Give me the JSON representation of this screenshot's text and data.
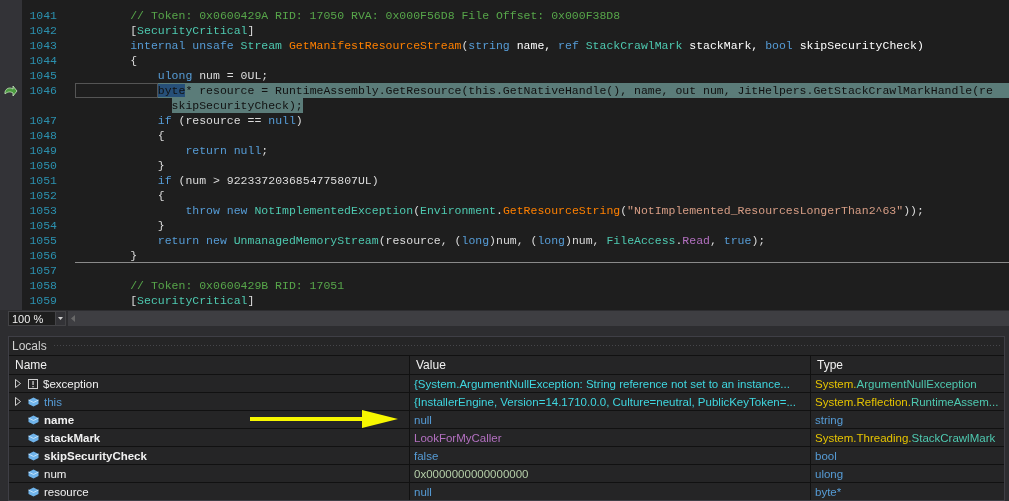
{
  "editor": {
    "blocks": [
      {
        "lines": [
          {
            "number": "1041",
            "current": false,
            "tokens": [
              {
                "text": "// Token: 0x0600429A RID: 17050 RVA: 0x000F56D8 File Offset: 0x000F38D8",
                "kind": "comment"
              }
            ]
          },
          {
            "number": "1042",
            "current": false,
            "tokens": [
              {
                "text": "[",
                "kind": "plain"
              },
              {
                "text": "SecurityCritical",
                "kind": "type"
              },
              {
                "text": "]",
                "kind": "plain"
              }
            ]
          },
          {
            "number": "1043",
            "current": false,
            "tokens": [
              {
                "text": "internal unsafe ",
                "kind": "kw"
              },
              {
                "text": "Stream ",
                "kind": "type"
              },
              {
                "text": "GetManifestResourceStream",
                "kind": "method"
              },
              {
                "text": "(",
                "kind": "plain"
              },
              {
                "text": "string",
                "kind": "kw"
              },
              {
                "text": " name, ",
                "kind": "param"
              },
              {
                "text": "ref ",
                "kind": "kw"
              },
              {
                "text": "StackCrawlMark",
                "kind": "type"
              },
              {
                "text": " stackMark, ",
                "kind": "param"
              },
              {
                "text": "bool",
                "kind": "kw"
              },
              {
                "text": " skipSecurityCheck)",
                "kind": "param"
              }
            ]
          },
          {
            "number": "1044",
            "current": false,
            "tokens": [
              {
                "text": "{",
                "kind": "plain"
              }
            ],
            "children": [
              {
                "number": "1045",
                "current": false,
                "tokens": [
                  {
                    "text": "ulong",
                    "kind": "kw"
                  },
                  {
                    "text": " num = 0UL;",
                    "kind": "plain"
                  }
                ]
              },
              {
                "number": "1046",
                "current": true,
                "tokens": [
                  {
                    "text": "byte",
                    "kind": "selection"
                  },
                  {
                    "text": "* resource = RuntimeAssembly.GetResource(this.GetNativeHandle(), name, out num, JitHelpers.GetStackCrawlMarkHandle(re",
                    "kind": "plain"
                  }
                ],
                "continuation": "skipSecurityCheck);"
              },
              {
                "number": "1047",
                "current": false,
                "tokens": [
                  {
                    "text": "if",
                    "kind": "kw"
                  },
                  {
                    "text": " (resource == ",
                    "kind": "plain"
                  },
                  {
                    "text": "null",
                    "kind": "kw"
                  },
                  {
                    "text": ")",
                    "kind": "plain"
                  }
                ]
              },
              {
                "number": "1048",
                "current": false,
                "tokens": [
                  {
                    "text": "{",
                    "kind": "plain"
                  }
                ],
                "children": [
                  {
                    "number": "1049",
                    "current": false,
                    "tokens": [
                      {
                        "text": "return null",
                        "kind": "kw"
                      },
                      {
                        "text": ";",
                        "kind": "plain"
                      }
                    ]
                  }
                ]
              },
              {
                "number": "1050",
                "current": false,
                "tokens": [
                  {
                    "text": "}",
                    "kind": "plain"
                  }
                ]
              },
              {
                "number": "1051",
                "current": false,
                "tokens": [
                  {
                    "text": "if",
                    "kind": "kw"
                  },
                  {
                    "text": " (num > 9223372036854775807UL)",
                    "kind": "plain"
                  }
                ]
              },
              {
                "number": "1052",
                "current": false,
                "tokens": [
                  {
                    "text": "{",
                    "kind": "plain"
                  }
                ],
                "children": [
                  {
                    "number": "1053",
                    "current": false,
                    "tokens": [
                      {
                        "text": "throw new ",
                        "kind": "kw"
                      },
                      {
                        "text": "NotImplementedException",
                        "kind": "type"
                      },
                      {
                        "text": "(",
                        "kind": "plain"
                      },
                      {
                        "text": "Environment",
                        "kind": "type"
                      },
                      {
                        "text": ".",
                        "kind": "plain"
                      },
                      {
                        "text": "GetResourceString",
                        "kind": "method"
                      },
                      {
                        "text": "(",
                        "kind": "plain"
                      },
                      {
                        "text": "\"NotImplemented_ResourcesLongerThan2^63\"",
                        "kind": "string"
                      },
                      {
                        "text": "));",
                        "kind": "plain"
                      }
                    ]
                  }
                ]
              },
              {
                "number": "1054",
                "current": false,
                "tokens": [
                  {
                    "text": "}",
                    "kind": "plain"
                  }
                ]
              },
              {
                "number": "1055",
                "current": false,
                "tokens": [
                  {
                    "text": "return new ",
                    "kind": "kw"
                  },
                  {
                    "text": "UnmanagedMemoryStream",
                    "kind": "type"
                  },
                  {
                    "text": "(resource, (",
                    "kind": "plain"
                  },
                  {
                    "text": "long",
                    "kind": "kw"
                  },
                  {
                    "text": ")num, (",
                    "kind": "plain"
                  },
                  {
                    "text": "long",
                    "kind": "kw"
                  },
                  {
                    "text": ")num, ",
                    "kind": "plain"
                  },
                  {
                    "text": "FileAccess",
                    "kind": "type"
                  },
                  {
                    "text": ".",
                    "kind": "plain"
                  },
                  {
                    "text": "Read",
                    "kind": "enum"
                  },
                  {
                    "text": ", ",
                    "kind": "plain"
                  },
                  {
                    "text": "true",
                    "kind": "kw"
                  },
                  {
                    "text": ");",
                    "kind": "plain"
                  }
                ]
              }
            ]
          },
          {
            "number": "1056",
            "current": false,
            "tokens": [
              {
                "text": "}",
                "kind": "plain"
              }
            ]
          }
        ]
      },
      {
        "lines": [
          {
            "number": "1057",
            "current": false
          },
          {
            "number": "1058",
            "current": false,
            "tokens": [
              {
                "text": "// Token: 0x0600429B RID: 17051",
                "kind": "comment"
              }
            ]
          },
          {
            "number": "1059",
            "current": false,
            "tokens": [
              {
                "text": "[",
                "kind": "plain"
              },
              {
                "text": "SecurityCritical",
                "kind": "type"
              },
              {
                "text": "]",
                "kind": "plain"
              }
            ]
          }
        ]
      }
    ]
  },
  "zoom": {
    "value": "100 %"
  },
  "locals": {
    "title": "Locals",
    "columns": [
      "Name",
      "Value",
      "Type"
    ],
    "rows": [
      {
        "kind": "exception",
        "name": "$exception",
        "bold": false,
        "keyword": false,
        "expandable": true,
        "value": "{System.ArgumentNullException: String reference not set to an instance...",
        "color": "#3fd7e0",
        "type": [
          {
            "text": "System.",
            "kind": "namespace"
          },
          {
            "text": "ArgumentNullException",
            "kind": "type"
          }
        ]
      },
      {
        "kind": "local",
        "name": "this",
        "bold": false,
        "keyword": true,
        "expandable": true,
        "value": "{InstallerEngine, Version=14.1710.0.0, Culture=neutral, PublicKeyToken=...",
        "color": "#3fd7e0",
        "type": [
          {
            "text": "System.Reflection.",
            "kind": "namespace"
          },
          {
            "text": "RuntimeAssem...",
            "kind": "type"
          }
        ]
      },
      {
        "kind": "local",
        "name": "name",
        "bold": true,
        "keyword": false,
        "expandable": false,
        "value": "null",
        "color": "#569cd6",
        "type": [
          {
            "text": "string",
            "kind": "keyword"
          }
        ]
      },
      {
        "kind": "local",
        "name": "stackMark",
        "bold": true,
        "keyword": false,
        "expandable": false,
        "value": "LookForMyCaller",
        "color": "#b370c0",
        "type": [
          {
            "text": "System.Threading.",
            "kind": "namespace"
          },
          {
            "text": "StackCrawlMark",
            "kind": "type"
          }
        ]
      },
      {
        "kind": "local",
        "name": "skipSecurityCheck",
        "bold": true,
        "keyword": false,
        "expandable": false,
        "value": "false",
        "color": "#569cd6",
        "type": [
          {
            "text": "bool",
            "kind": "keyword"
          }
        ]
      },
      {
        "kind": "local",
        "name": "num",
        "bold": false,
        "keyword": false,
        "expandable": false,
        "value": "0x0000000000000000",
        "color": "#b5cea8",
        "type": [
          {
            "text": "ulong",
            "kind": "keyword"
          }
        ]
      },
      {
        "kind": "local",
        "name": "resource",
        "bold": false,
        "keyword": false,
        "expandable": false,
        "value": "null",
        "color": "#569cd6",
        "type": [
          {
            "text": "byte*",
            "kind": "keyword"
          }
        ]
      }
    ]
  }
}
